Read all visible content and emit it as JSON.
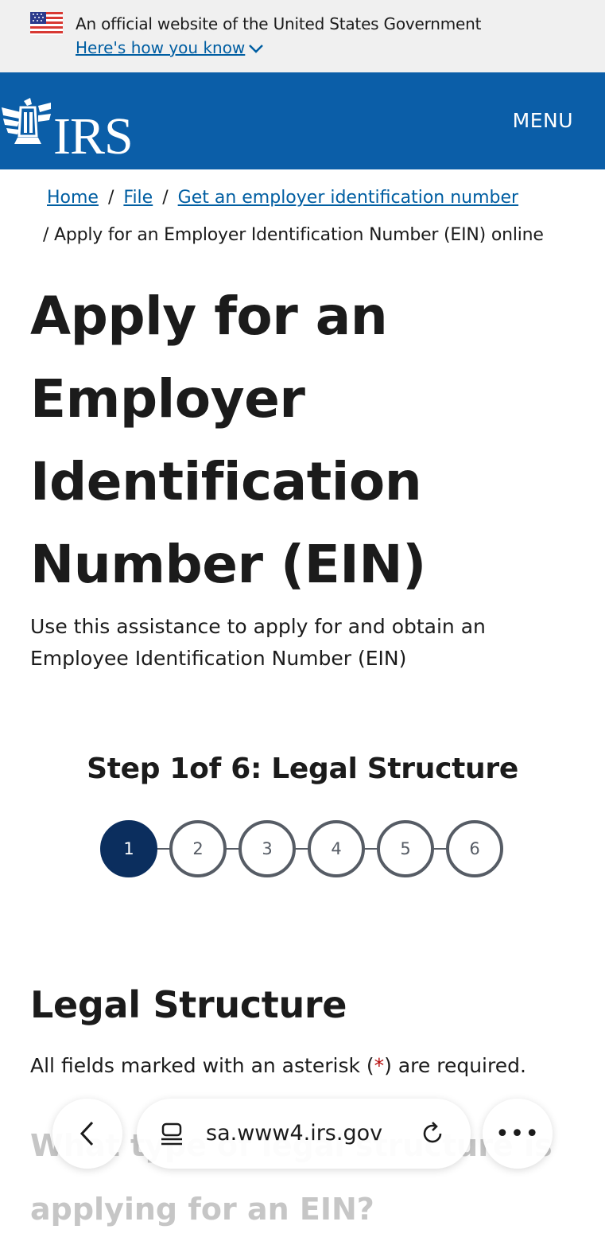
{
  "gov_banner": {
    "text": "An official website of the United States Government",
    "link": "Here's how you know"
  },
  "header": {
    "logo_text": "IRS",
    "menu_label": "MENU",
    "brand_color": "#0b5ea8"
  },
  "breadcrumb": {
    "items": [
      "Home",
      "File",
      "Get an employer identification number"
    ],
    "current": "Apply for an Employer Identification Number (EIN) online",
    "separator": "/"
  },
  "main": {
    "title": "Apply for an Employer Identification Number (EIN)",
    "lead": "Use this assistance to apply for and obtain an Employee Identification Number (EIN)"
  },
  "progress": {
    "heading": "Step 1of 6: Legal Structure",
    "steps": [
      "1",
      "2",
      "3",
      "4",
      "5",
      "6"
    ],
    "current_step": 1,
    "total_steps": 6
  },
  "form": {
    "section_title": "Legal Structure",
    "required_prefix": "All fields marked with an asterisk (",
    "required_asterisk": "*",
    "required_suffix": ") are required.",
    "question": "What type of legal structure is applying for an EIN?"
  },
  "browser": {
    "url": "sa.www4.irs.gov",
    "more_label": "•••",
    "icons": [
      "back-arrow-icon",
      "page-icon",
      "reload-icon",
      "more-icon"
    ]
  }
}
